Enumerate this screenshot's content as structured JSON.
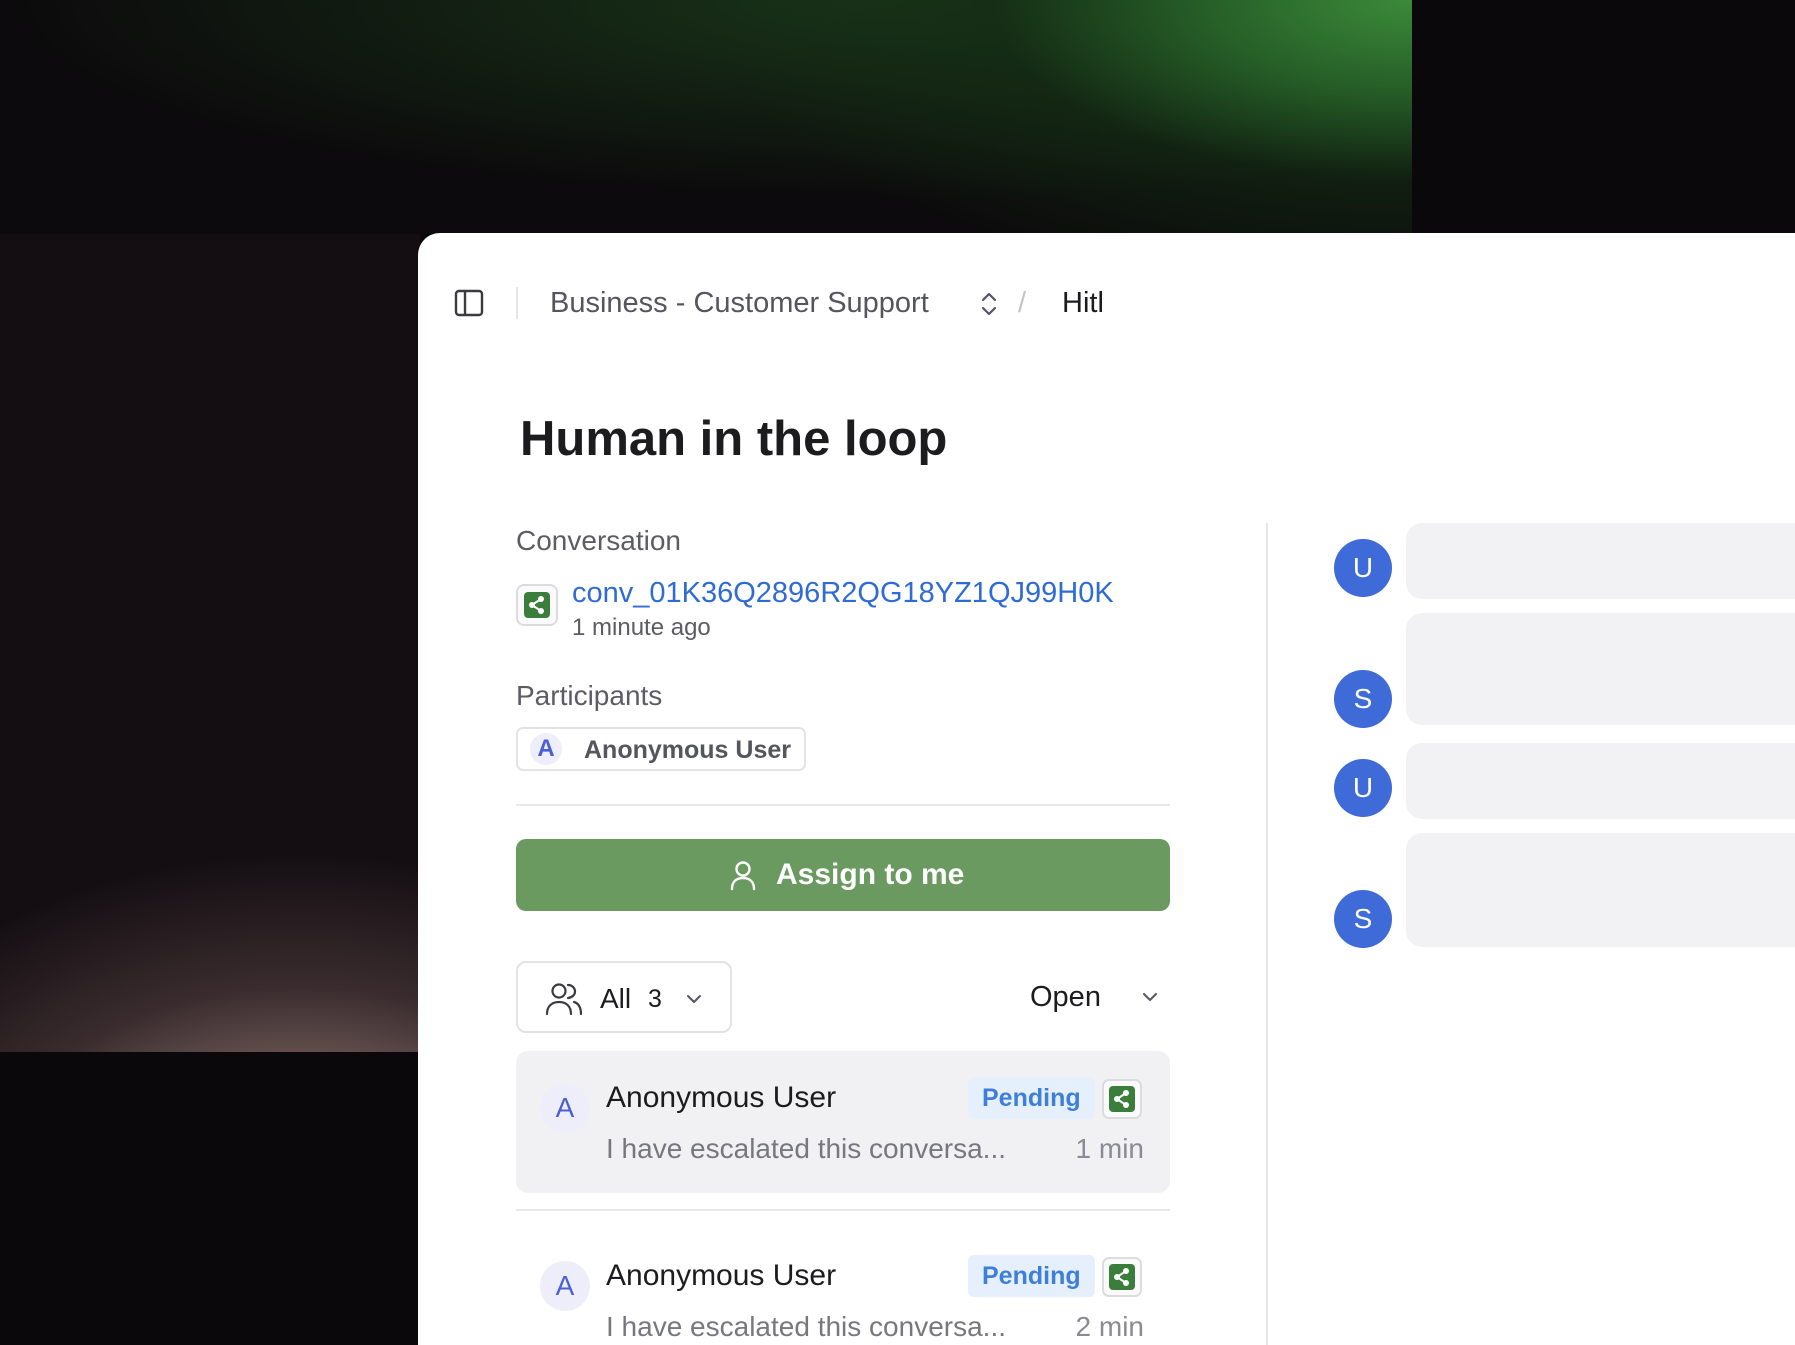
{
  "breadcrumb": {
    "org": "Business - Customer Support",
    "separator": "/",
    "current": "Hitl"
  },
  "page": {
    "title": "Human in the loop"
  },
  "conversation": {
    "label": "Conversation",
    "id": "conv_01K36Q2896R2QG18YZ1QJ99H0K",
    "time": "1 minute ago"
  },
  "participants": {
    "label": "Participants",
    "items": [
      {
        "initial": "A",
        "name": "Anonymous User"
      }
    ]
  },
  "assign_button": {
    "label": "Assign to me"
  },
  "filter": {
    "label": "All",
    "count": "3",
    "status": "Open"
  },
  "list": [
    {
      "initial": "A",
      "name": "Anonymous User",
      "status": "Pending",
      "preview": "I have escalated this conversa...",
      "time": "1 min",
      "selected": true
    },
    {
      "initial": "A",
      "name": "Anonymous User",
      "status": "Pending",
      "preview": "I have escalated this conversa...",
      "time": "2 min",
      "selected": false
    }
  ],
  "chat": {
    "messages": [
      {
        "initial": "U"
      },
      {
        "initial": "S"
      },
      {
        "initial": "U"
      },
      {
        "initial": "S"
      }
    ]
  },
  "colors": {
    "accent_green": "#6a9a5f",
    "link_blue": "#2f6bd6",
    "pending_badge": "#3d7fd9",
    "avatar_blue": "#3f6bd8"
  },
  "icons": [
    "sidebar-toggle-icon",
    "chevron-up-down-icon",
    "share-icon",
    "user-icon",
    "users-icon",
    "chevron-down-icon"
  ]
}
